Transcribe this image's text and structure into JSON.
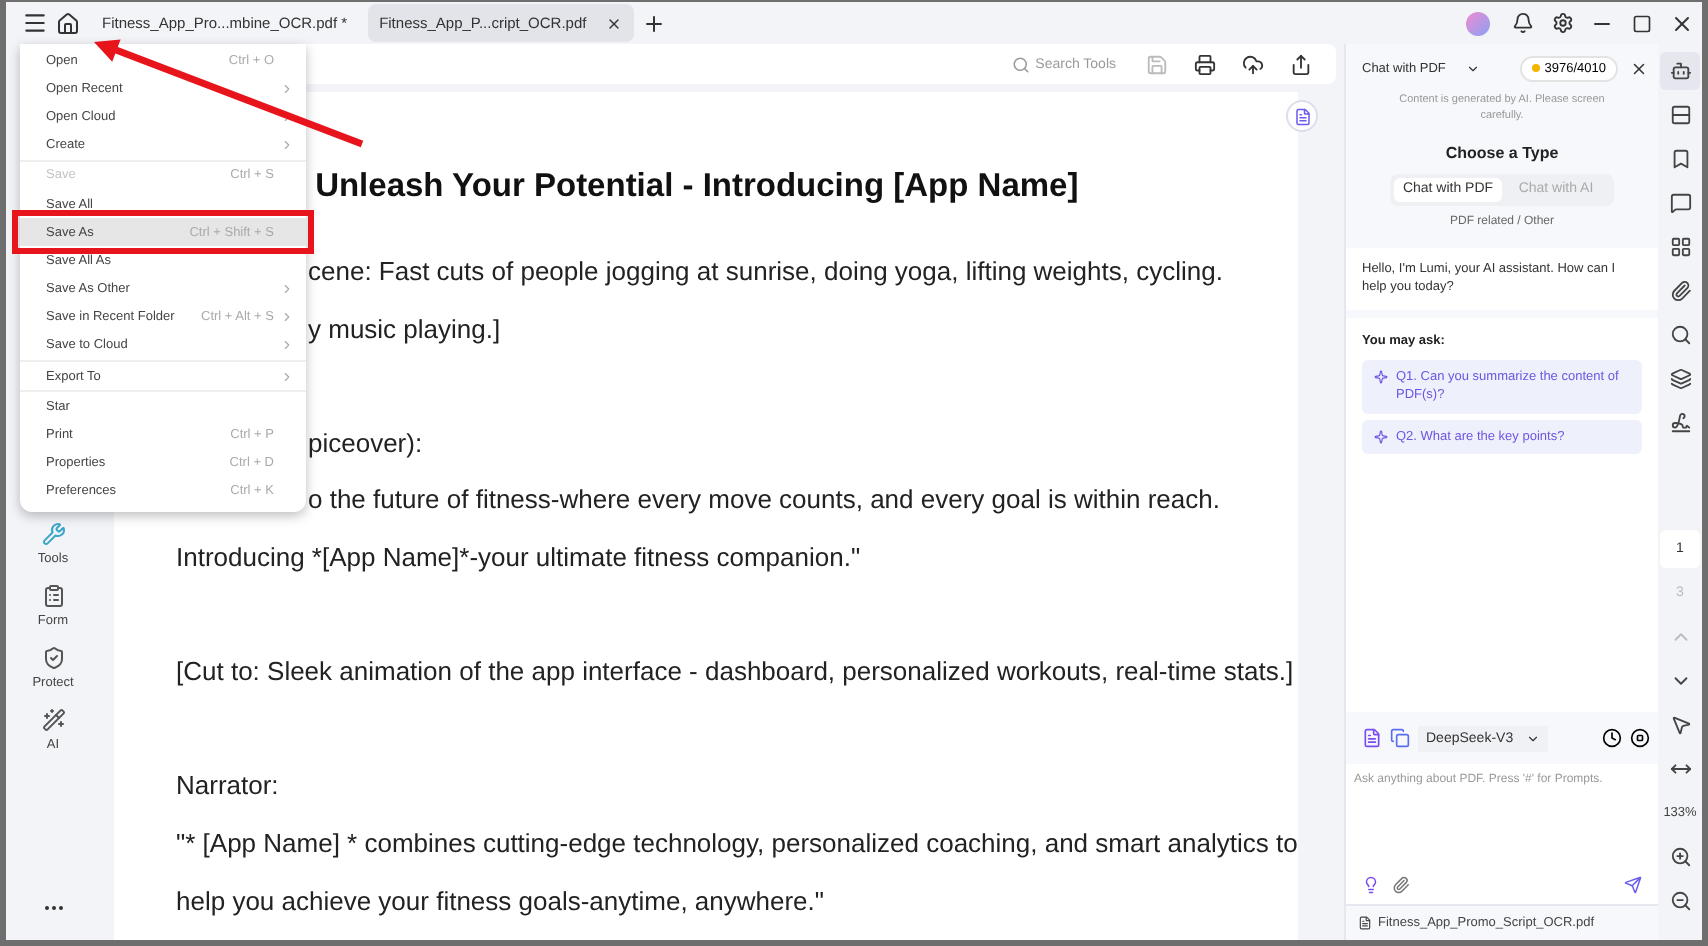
{
  "tabs": [
    {
      "label": "Fitness_App_Pro...mbine_OCR.pdf *",
      "selected": false,
      "closable": false
    },
    {
      "label": "Fitness_App_P...cript_OCR.pdf",
      "selected": true,
      "closable": true
    }
  ],
  "file_menu": [
    {
      "kind": "item",
      "label": "Open",
      "shortcut": "Ctrl + O",
      "submenu": false,
      "disabled": false,
      "highlighted": false
    },
    {
      "kind": "item",
      "label": "Open Recent",
      "submenu": true,
      "disabled": false,
      "highlighted": false
    },
    {
      "kind": "item",
      "label": "Open Cloud",
      "submenu": true,
      "disabled": false,
      "highlighted": false
    },
    {
      "kind": "item",
      "label": "Create",
      "submenu": true,
      "disabled": false,
      "highlighted": false
    },
    {
      "kind": "separator"
    },
    {
      "kind": "item",
      "label": "Save",
      "shortcut": "Ctrl + S",
      "submenu": false,
      "disabled": true,
      "highlighted": false
    },
    {
      "kind": "item",
      "label": "Save All",
      "submenu": false,
      "disabled": false,
      "highlighted": false
    },
    {
      "kind": "item",
      "label": "Save As",
      "shortcut": "Ctrl + Shift + S",
      "submenu": false,
      "disabled": false,
      "highlighted": true
    },
    {
      "kind": "item",
      "label": "Save All As",
      "submenu": false,
      "disabled": false,
      "highlighted": false
    },
    {
      "kind": "item",
      "label": "Save As Other",
      "submenu": true,
      "disabled": false,
      "highlighted": false
    },
    {
      "kind": "item",
      "label": "Save in Recent Folder",
      "shortcut": "Ctrl + Alt + S",
      "submenu": true,
      "disabled": false,
      "highlighted": false
    },
    {
      "kind": "item",
      "label": "Save to Cloud",
      "submenu": true,
      "disabled": false,
      "highlighted": false
    },
    {
      "kind": "separator"
    },
    {
      "kind": "item",
      "label": "Export To",
      "submenu": true,
      "disabled": false,
      "highlighted": false
    },
    {
      "kind": "separator"
    },
    {
      "kind": "item",
      "label": "Star",
      "submenu": false,
      "disabled": false,
      "highlighted": false
    },
    {
      "kind": "item",
      "label": "Print",
      "shortcut": "Ctrl + P",
      "submenu": false,
      "disabled": false,
      "highlighted": false
    },
    {
      "kind": "item",
      "label": "Properties",
      "shortcut": "Ctrl + D",
      "submenu": false,
      "disabled": false,
      "highlighted": false
    },
    {
      "kind": "item",
      "label": "Preferences",
      "shortcut": "Ctrl + K",
      "submenu": false,
      "disabled": false,
      "highlighted": false
    }
  ],
  "sidebar": {
    "items": [
      {
        "kind": "tools",
        "label": "Tools"
      },
      {
        "kind": "form",
        "label": "Form"
      },
      {
        "kind": "protect",
        "label": "Protect"
      },
      {
        "kind": "ai",
        "label": "AI"
      }
    ]
  },
  "toolbar": {
    "search_placeholder": "Search Tools"
  },
  "document": {
    "title": "Unleash Your Potential - Introducing [App Name]",
    "paragraphs": [
      [
        {
          "text": "cene: Fast cuts of people jogging at sunrise, doing yoga, lifting weights, cycling.",
          "partial": true
        },
        {
          "text": "y music playing.]",
          "partial": true
        }
      ],
      [
        {
          "text": "piceover):",
          "partial": true
        },
        {
          "text": "o the future of fitness-where every move counts, and every goal is within reach.",
          "partial": true
        },
        {
          "text": "Introducing *[App Name]*-your ultimate fitness companion.\""
        }
      ],
      [
        {
          "text": "[Cut to: Sleek animation of the app interface - dashboard, personalized workouts, real-time stats.]"
        }
      ],
      [
        {
          "text": "Narrator:"
        },
        {
          "text": "\"* [App Name] * combines cutting-edge technology, personalized coaching, and smart analytics to"
        },
        {
          "text": "help you achieve your fitness goals-anytime, anywhere.\""
        }
      ]
    ]
  },
  "chat": {
    "mode": "Chat with PDF",
    "credits": "3976/4010",
    "notice": "Content is generated by AI. Please screen carefully.",
    "type_heading": "Choose a Type",
    "types": [
      {
        "label": "Chat with PDF",
        "selected": true
      },
      {
        "label": "Chat with AI",
        "selected": false
      }
    ],
    "type_caption": "PDF related / Other",
    "greeting": "Hello, I'm Lumi, your AI assistant. How can I help you today?",
    "suggest_heading": "You may ask:",
    "suggestions": [
      "Q1. Can you summarize the content of PDF(s)?",
      "Q2. What are the key points?"
    ],
    "model": "DeepSeek-V3",
    "input_placeholder": "Ask anything about PDF. Press '#' for Prompts.",
    "file": "Fitness_App_Promo_Script_OCR.pdf"
  },
  "rail": {
    "pages": [
      {
        "label": "1",
        "selected": true
      },
      {
        "label": "3",
        "selected": false
      }
    ],
    "zoom": "133%"
  }
}
